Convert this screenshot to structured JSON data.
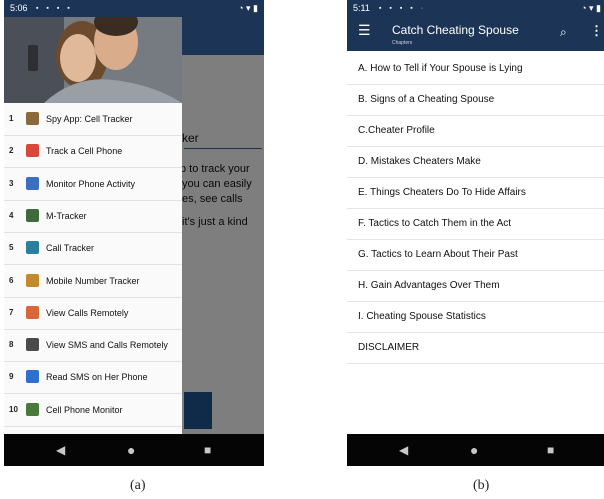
{
  "panel_a": {
    "status": {
      "time": "5:06",
      "notifications": "▪ ▪ ▪ ▪",
      "system": "◔ ▾ ▮"
    },
    "background_fragments": [
      "ker",
      "p to track your",
      "you can easily",
      "es, see calls",
      "it's just a kind"
    ],
    "drawer_items": [
      {
        "num": "1",
        "label": "Spy App: Cell Tracker",
        "icon": "spy-app-icon",
        "color": "#8a6a3a"
      },
      {
        "num": "2",
        "label": "Track a Cell Phone",
        "icon": "track-phone-icon",
        "color": "#d9463a"
      },
      {
        "num": "3",
        "label": "Monitor Phone Activity",
        "icon": "monitor-activity-icon",
        "color": "#3b6fc2"
      },
      {
        "num": "4",
        "label": "M-Tracker",
        "icon": "m-tracker-icon",
        "color": "#3f6b3c"
      },
      {
        "num": "5",
        "label": "Call Tracker",
        "icon": "call-tracker-icon",
        "color": "#2a7fa0"
      },
      {
        "num": "6",
        "label": "Mobile Number Tracker",
        "icon": "number-tracker-icon",
        "color": "#c28a2a"
      },
      {
        "num": "7",
        "label": "View Calls Remotely",
        "icon": "view-calls-icon",
        "color": "#d9663a"
      },
      {
        "num": "8",
        "label": "View SMS and Calls Remotely",
        "icon": "sms-calls-icon",
        "color": "#4a4a4a"
      },
      {
        "num": "9",
        "label": "Read SMS on Her Phone",
        "icon": "read-sms-icon",
        "color": "#2f6fd0"
      },
      {
        "num": "10",
        "label": "Cell Phone Monitor",
        "icon": "phone-monitor-icon",
        "color": "#4a7a3a"
      }
    ],
    "nav": {
      "back": "◀",
      "home": "●",
      "recent": "■"
    }
  },
  "panel_b": {
    "status": {
      "time": "5:11",
      "notifications": "▪ ▪ ▪ ▪ ·",
      "system": "◔ ▾ ▮"
    },
    "appbar": {
      "menu_icon": "☰",
      "title": "Catch Cheating Spouse",
      "subtitle": "Chapters",
      "search_icon": "⌕",
      "more_icon": "⋮"
    },
    "chapters": [
      "A. How to Tell if Your Spouse is Lying",
      "B. Signs of a Cheating Spouse",
      "C.Cheater Profile",
      "D. Mistakes Cheaters Make",
      "E. Things Cheaters Do To Hide Affairs",
      "F. Tactics to Catch Them in the Act",
      "G. Tactics to Learn About Their Past",
      "H. Gain Advantages Over Them",
      "I. Cheating Spouse Statistics",
      "DISCLAIMER"
    ],
    "nav": {
      "back": "◀",
      "home": "●",
      "recent": "■"
    }
  },
  "captions": {
    "a": "(a)",
    "b": "(b)"
  },
  "colors": {
    "appbar": "#1c3557",
    "navbar": "#050505"
  }
}
